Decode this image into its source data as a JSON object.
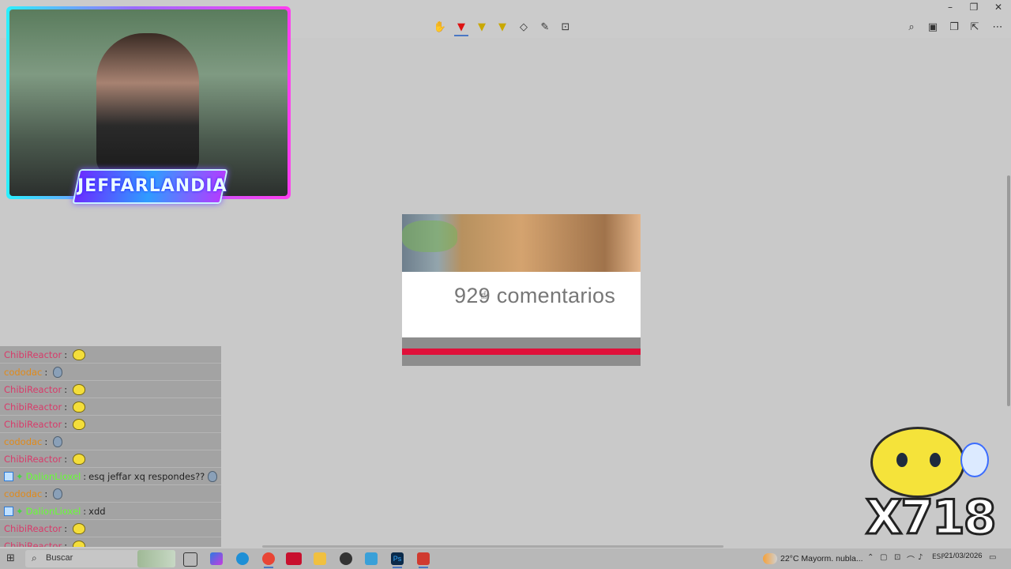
{
  "toolbar": {
    "icons": [
      "touch-write-icon",
      "ballpoint-pen-icon",
      "highlighter-icon",
      "highlighter-alt-icon",
      "eraser-icon",
      "ruler-icon",
      "crop-icon"
    ],
    "right_icons": [
      "zoom-icon",
      "save-icon",
      "copy-icon",
      "share-icon",
      "more-icon"
    ]
  },
  "overlay": {
    "brand": "JEFFARLANDIA"
  },
  "image": {
    "comments": "929 comentarios",
    "progress": 1.0,
    "progress_color": "#e0103a"
  },
  "chat": {
    "messages": [
      {
        "user": "ChibiReactor",
        "color": "#d83b6a",
        "text": "",
        "emote": "smiley"
      },
      {
        "user": "cododac",
        "color": "#e08a1a",
        "text": "",
        "emote": "gray"
      },
      {
        "user": "ChibiReactor",
        "color": "#d83b6a",
        "text": "",
        "emote": "smiley"
      },
      {
        "user": "ChibiReactor",
        "color": "#d83b6a",
        "text": "",
        "emote": "smiley"
      },
      {
        "user": "ChibiReactor",
        "color": "#d83b6a",
        "text": "",
        "emote": "smiley"
      },
      {
        "user": "cododac",
        "color": "#e08a1a",
        "text": "",
        "emote": "gray"
      },
      {
        "user": "ChibiReactor",
        "color": "#d83b6a",
        "text": "",
        "emote": "smiley"
      },
      {
        "user": "DalionLioxel",
        "color": "#66ff33",
        "text": "esq jeffar xq respondes??",
        "emote": "gray",
        "badge": true
      },
      {
        "user": "cododac",
        "color": "#e08a1a",
        "text": "",
        "emote": "gray"
      },
      {
        "user": "DalionLioxel",
        "color": "#66ff33",
        "text": "xdd",
        "emote": "",
        "badge": true
      },
      {
        "user": "ChibiReactor",
        "color": "#d83b6a",
        "text": "",
        "emote": "smiley"
      },
      {
        "user": "ChibiReactor",
        "color": "#d83b6a",
        "text": "",
        "emote": "smiley"
      }
    ]
  },
  "combo": {
    "count": "X718"
  },
  "taskbar": {
    "search_label": "Buscar",
    "weather": "22°C  Mayorm. nubla...",
    "language": "ESP",
    "date": "21/03/2026"
  }
}
